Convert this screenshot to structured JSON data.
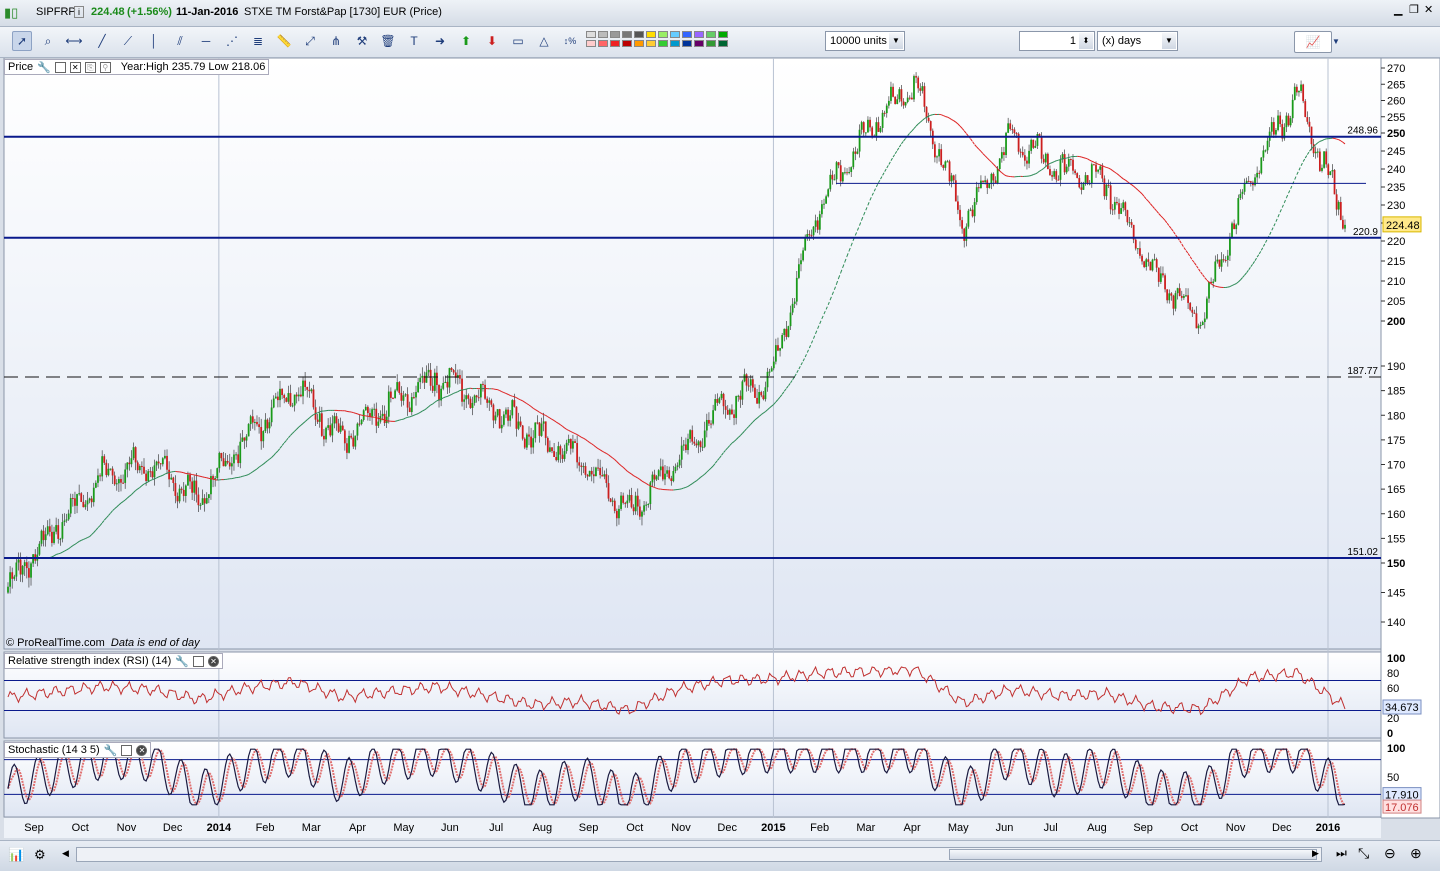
{
  "window": {
    "symbol": "SIPFRP",
    "last": "224.48",
    "change": "(+1.56%)",
    "date": "11-Jan-2016",
    "instrument": "STXE TM Forst&Pap [1730] EUR (Price)"
  },
  "toolbar": {
    "units_value": "10000 units",
    "period_value": "1",
    "period_unit": "(x) days"
  },
  "price_panel": {
    "label": "Price",
    "year_info": "Year:High 235.79 Low 218.06",
    "copyright": "© ProRealTime.com",
    "end_note": "Data is end of day",
    "y_ticks": [
      "270",
      "265",
      "260",
      "255",
      "250",
      "245",
      "240",
      "235",
      "230",
      "225",
      "220",
      "215",
      "210",
      "205",
      "200",
      "190",
      "185",
      "180",
      "175",
      "170",
      "165",
      "160",
      "155",
      "150",
      "145",
      "140"
    ],
    "last_price_tag": "224.48",
    "hlines": [
      {
        "label": "248.96",
        "value": 248.96
      },
      {
        "label": "220.9",
        "value": 220.9
      },
      {
        "label": "187.77",
        "value": 187.77
      },
      {
        "label": "151.02",
        "value": 151.02
      }
    ]
  },
  "rsi_panel": {
    "label": "Relative strength index (RSI) (14)",
    "y_ticks": [
      "100",
      "80",
      "60",
      "40",
      "20",
      "0"
    ],
    "value_tag": "34.673"
  },
  "stoch_panel": {
    "label": "Stochastic (14 3 5)",
    "y_ticks": [
      "100",
      "50",
      "0"
    ],
    "value_tag1": "17.910",
    "value_tag2": "17.076"
  },
  "x_axis": {
    "labels": [
      "Sep",
      "Oct",
      "Nov",
      "Dec",
      "2014",
      "Feb",
      "Mar",
      "Apr",
      "May",
      "Jun",
      "Jul",
      "Aug",
      "Sep",
      "Oct",
      "Nov",
      "Dec",
      "2015",
      "Feb",
      "Mar",
      "Apr",
      "May",
      "Jun",
      "Jul",
      "Aug",
      "Sep",
      "Oct",
      "Nov",
      "Dec",
      "2016"
    ]
  },
  "colors": {
    "up": "#1a9a1a",
    "down": "#cc1f1f",
    "hline": "#0a1a8c",
    "ma": "#2e8b57",
    "ma_down": "#dd2222",
    "bg_top": "#ffffff",
    "bg_bottom": "#dfe6f3"
  },
  "chart_data": {
    "type": "line",
    "title": "STXE TM Forst&Pap [1730] EUR (Price)",
    "x": [
      "Sep",
      "Oct",
      "Nov",
      "Dec",
      "2014",
      "Feb",
      "Mar",
      "Apr",
      "May",
      "Jun",
      "Jul",
      "Aug",
      "Sep",
      "Oct",
      "Nov",
      "Dec",
      "2015",
      "Feb",
      "Mar",
      "Apr",
      "May",
      "Jun",
      "Jul",
      "Aug",
      "Sep",
      "Oct",
      "Nov",
      "Dec",
      "2016"
    ],
    "series": [
      {
        "values": [
          146,
          157,
          168,
          170,
          163,
          176,
          186,
          175,
          182,
          188,
          183,
          176,
          171,
          160,
          171,
          182,
          188,
          230,
          251,
          265,
          225,
          249,
          240,
          236,
          212,
          200,
          237,
          262,
          224.48
        ]
      }
    ],
    "ylim": [
      137,
      272
    ],
    "rsi": [
      48,
      55,
      62,
      58,
      45,
      60,
      68,
      48,
      55,
      62,
      50,
      38,
      42,
      30,
      58,
      70,
      72,
      80,
      82,
      85,
      40,
      58,
      50,
      52,
      35,
      32,
      74,
      80,
      34.673
    ],
    "stochastic": [
      30,
      60,
      85,
      80,
      20,
      70,
      90,
      40,
      80,
      90,
      60,
      20,
      50,
      10,
      70,
      90,
      95,
      95,
      95,
      95,
      20,
      90,
      50,
      70,
      25,
      20,
      95,
      95,
      17.91
    ]
  }
}
